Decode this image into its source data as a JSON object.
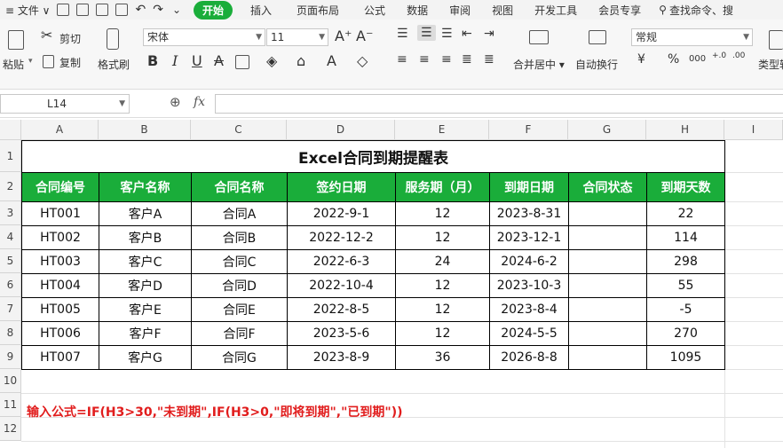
{
  "menubar": {
    "file": "≡ 文件 ∨",
    "undo_more": "⌄",
    "tabs": [
      "开始",
      "插入",
      "页面布局",
      "公式",
      "数据",
      "审阅",
      "视图",
      "开发工具",
      "会员专享"
    ],
    "search_placeholder": "查找命令、搜"
  },
  "ribbon": {
    "paste": "粘贴",
    "cut": "剪切",
    "copy": "复制",
    "format_painter": "格式刷",
    "font": "宋体",
    "size": "11",
    "bold": "B",
    "italic": "I",
    "underline": "U",
    "merge_center": "合并居中",
    "wrap_text": "自动换行",
    "number_format": "常规",
    "currency": "¥",
    "percent": "%",
    "thousands": "000",
    "inc_dec": "+.0",
    "dec_dec": ".00",
    "type_convert": "类型转"
  },
  "formula_bar": {
    "name_box": "L14",
    "fx": "fx",
    "formula": ""
  },
  "columns": [
    "A",
    "B",
    "C",
    "D",
    "E",
    "F",
    "G",
    "H",
    "I"
  ],
  "rows": [
    "1",
    "2",
    "3",
    "4",
    "5",
    "6",
    "7",
    "8",
    "9",
    "10",
    "11",
    "12"
  ],
  "sheet": {
    "title": "Excel合同到期提醒表",
    "headers": [
      "合同编号",
      "客户名称",
      "合同名称",
      "签约日期",
      "服务期（月）",
      "到期日期",
      "合同状态",
      "到期天数"
    ],
    "data": [
      [
        "HT001",
        "客户A",
        "合同A",
        "2022-9-1",
        "12",
        "2023-8-31",
        "",
        "22"
      ],
      [
        "HT002",
        "客户B",
        "合同B",
        "2022-12-2",
        "12",
        "2023-12-1",
        "",
        "114"
      ],
      [
        "HT003",
        "客户C",
        "合同C",
        "2022-6-3",
        "24",
        "2024-6-2",
        "",
        "298"
      ],
      [
        "HT004",
        "客户D",
        "合同D",
        "2022-10-4",
        "12",
        "2023-10-3",
        "",
        "55"
      ],
      [
        "HT005",
        "客户E",
        "合同E",
        "2022-8-5",
        "12",
        "2023-8-4",
        "",
        "-5"
      ],
      [
        "HT006",
        "客户F",
        "合同F",
        "2023-5-6",
        "12",
        "2024-5-5",
        "",
        "270"
      ],
      [
        "HT007",
        "客户G",
        "合同G",
        "2023-8-9",
        "36",
        "2026-8-8",
        "",
        "1095"
      ]
    ],
    "note": "输入公式=IF(H3>30,\"未到期\",IF(H3>0,\"即将到期\",\"已到期\"))"
  },
  "colors": {
    "accent": "#1aad3a",
    "note": "#e11d1d"
  }
}
